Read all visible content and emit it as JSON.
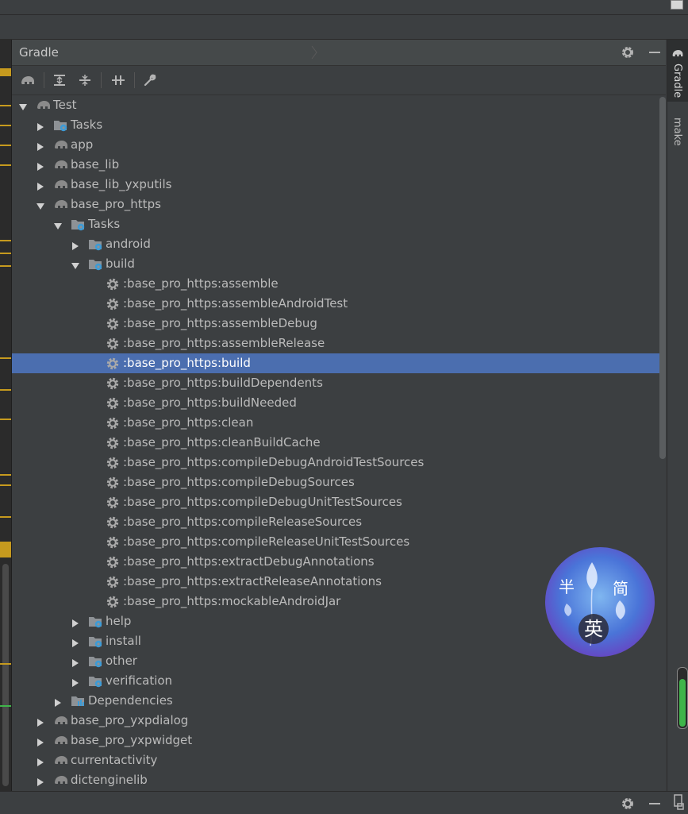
{
  "panel": {
    "title": "Gradle"
  },
  "toolbar": {
    "icons": [
      "gradle-elephant-icon",
      "expand-all-icon",
      "collapse-all-icon",
      "toggle-offline-icon",
      "wrench-icon"
    ]
  },
  "sidebar": {
    "tabs": [
      {
        "label": "Gradle",
        "active": true
      },
      {
        "label": "make",
        "active": false
      }
    ]
  },
  "tree": [
    {
      "label": "Test",
      "level": 0,
      "arrow": "down",
      "icon": "gradle-elephant-icon"
    },
    {
      "label": "Tasks",
      "level": 1,
      "arrow": "right",
      "icon": "tasks-folder-icon"
    },
    {
      "label": "app",
      "level": 1,
      "arrow": "right",
      "icon": "gradle-elephant-icon"
    },
    {
      "label": "base_lib",
      "level": 1,
      "arrow": "right",
      "icon": "gradle-elephant-icon"
    },
    {
      "label": "base_lib_yxputils",
      "level": 1,
      "arrow": "right",
      "icon": "gradle-elephant-icon"
    },
    {
      "label": "base_pro_https",
      "level": 1,
      "arrow": "down",
      "icon": "gradle-elephant-icon"
    },
    {
      "label": "Tasks",
      "level": 2,
      "arrow": "down",
      "icon": "tasks-folder-icon"
    },
    {
      "label": "android",
      "level": 3,
      "arrow": "right",
      "icon": "tasks-folder-icon"
    },
    {
      "label": "build",
      "level": 3,
      "arrow": "down",
      "icon": "tasks-folder-icon"
    },
    {
      "label": ":base_pro_https:assemble",
      "level": 4,
      "arrow": "none",
      "icon": "gear-icon"
    },
    {
      "label": ":base_pro_https:assembleAndroidTest",
      "level": 4,
      "arrow": "none",
      "icon": "gear-icon"
    },
    {
      "label": ":base_pro_https:assembleDebug",
      "level": 4,
      "arrow": "none",
      "icon": "gear-icon"
    },
    {
      "label": ":base_pro_https:assembleRelease",
      "level": 4,
      "arrow": "none",
      "icon": "gear-icon"
    },
    {
      "label": ":base_pro_https:build",
      "level": 4,
      "arrow": "none",
      "icon": "gear-icon",
      "selected": true
    },
    {
      "label": ":base_pro_https:buildDependents",
      "level": 4,
      "arrow": "none",
      "icon": "gear-icon"
    },
    {
      "label": ":base_pro_https:buildNeeded",
      "level": 4,
      "arrow": "none",
      "icon": "gear-icon"
    },
    {
      "label": ":base_pro_https:clean",
      "level": 4,
      "arrow": "none",
      "icon": "gear-icon"
    },
    {
      "label": ":base_pro_https:cleanBuildCache",
      "level": 4,
      "arrow": "none",
      "icon": "gear-icon"
    },
    {
      "label": ":base_pro_https:compileDebugAndroidTestSources",
      "level": 4,
      "arrow": "none",
      "icon": "gear-icon"
    },
    {
      "label": ":base_pro_https:compileDebugSources",
      "level": 4,
      "arrow": "none",
      "icon": "gear-icon"
    },
    {
      "label": ":base_pro_https:compileDebugUnitTestSources",
      "level": 4,
      "arrow": "none",
      "icon": "gear-icon"
    },
    {
      "label": ":base_pro_https:compileReleaseSources",
      "level": 4,
      "arrow": "none",
      "icon": "gear-icon"
    },
    {
      "label": ":base_pro_https:compileReleaseUnitTestSources",
      "level": 4,
      "arrow": "none",
      "icon": "gear-icon"
    },
    {
      "label": ":base_pro_https:extractDebugAnnotations",
      "level": 4,
      "arrow": "none",
      "icon": "gear-icon"
    },
    {
      "label": ":base_pro_https:extractReleaseAnnotations",
      "level": 4,
      "arrow": "none",
      "icon": "gear-icon"
    },
    {
      "label": ":base_pro_https:mockableAndroidJar",
      "level": 4,
      "arrow": "none",
      "icon": "gear-icon"
    },
    {
      "label": "help",
      "level": 3,
      "arrow": "right",
      "icon": "tasks-folder-icon"
    },
    {
      "label": "install",
      "level": 3,
      "arrow": "right",
      "icon": "tasks-folder-icon"
    },
    {
      "label": "other",
      "level": 3,
      "arrow": "right",
      "icon": "tasks-folder-icon"
    },
    {
      "label": "verification",
      "level": 3,
      "arrow": "right",
      "icon": "tasks-folder-icon"
    },
    {
      "label": "Dependencies",
      "level": 2,
      "arrow": "right",
      "icon": "dependencies-folder-icon"
    },
    {
      "label": "base_pro_yxpdialog",
      "level": 1,
      "arrow": "right",
      "icon": "gradle-elephant-icon"
    },
    {
      "label": "base_pro_yxpwidget",
      "level": 1,
      "arrow": "right",
      "icon": "gradle-elephant-icon"
    },
    {
      "label": "currentactivity",
      "level": 1,
      "arrow": "right",
      "icon": "gradle-elephant-icon"
    },
    {
      "label": "dictenginelib",
      "level": 1,
      "arrow": "right",
      "icon": "gradle-elephant-icon"
    }
  ],
  "watermark": {
    "chars": [
      "半",
      "简",
      "英"
    ]
  },
  "colors": {
    "selection": "#4b6eaf",
    "background": "#3c3f41",
    "text": "#bbbbbb",
    "accent_gear": "#3d9bd6",
    "progress": "#3fb54a"
  }
}
